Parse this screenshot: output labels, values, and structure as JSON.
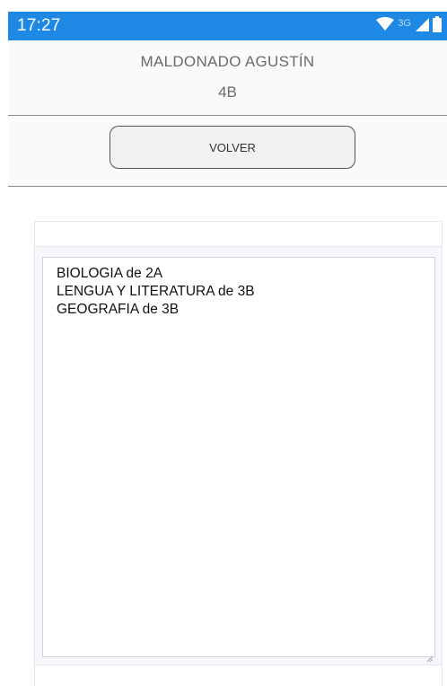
{
  "status_bar": {
    "time": "17:27",
    "network_label": "3G",
    "icons": [
      "wifi-icon",
      "signal-icon",
      "battery-icon"
    ],
    "color": "#1e88e5"
  },
  "header": {
    "student_name": "MALDONADO AGUSTÍN",
    "course": "4B"
  },
  "actions": {
    "back_label": "VOLVER"
  },
  "subjects": {
    "items": [
      "BIOLOGIA de 2A",
      "LENGUA Y LITERATURA de 3B",
      "GEOGRAFIA de 3B"
    ]
  }
}
